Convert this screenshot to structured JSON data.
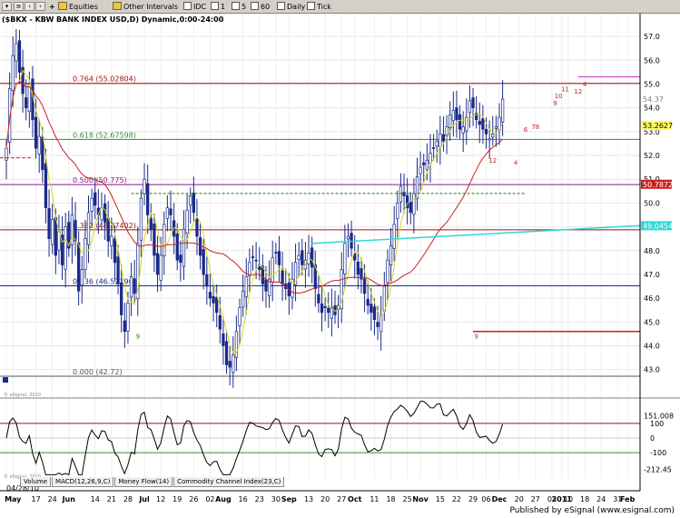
{
  "toolbar": {
    "equities": "Equities",
    "other_intervals": "Other Intervals",
    "idc": "IDC",
    "int_1": "1",
    "int_5": "5",
    "int_60": "60",
    "daily": "Daily",
    "tick": "Tick",
    "add_symbol": "+"
  },
  "chart": {
    "title": "($BKX - KBW BANK INDEX USD,D) Dynamic,0:00-24:00",
    "watermark": "© eSignal, 2010",
    "watermark_lower": "© eSignal, 2010",
    "tabs": [
      "Volume",
      "MACD(12,26,9,C)",
      "Money Flow(14)",
      "Commodity Channel Index(23,C)"
    ],
    "footer": "Published by eSignal (www.esignal.com)",
    "colors": {
      "candle_up": "#ffffff",
      "candle_down": "#1a2a8a",
      "fib_764": "#a01010",
      "fib_618": "#3a8a3a",
      "fib_500": "#8a1a8a",
      "fib_382": "#a01010",
      "fib_236": "#1a2a8a",
      "fib_000": "#555555",
      "ma_short": "#d8d820",
      "ma_long": "#cc2020",
      "trend_cyan": "#30d8d8",
      "support_red": "#cc2020",
      "resistance_green": "#1a7a1a",
      "magenta_line": "#cc20cc",
      "cci_line": "#000000"
    }
  },
  "chart_data": [
    {
      "type": "candlestick",
      "title": "($BKX - KBW BANK INDEX USD,D) Dynamic,0:00-24:00",
      "ylim": [
        42.3,
        57.5
      ],
      "x_labels": [
        {
          "label": "04/28/10",
          "i": 0
        },
        {
          "label": "May",
          "i": 2
        },
        {
          "label": "17",
          "i": 9
        },
        {
          "label": "24",
          "i": 14
        },
        {
          "label": "Jun",
          "i": 19
        },
        {
          "label": "14",
          "i": 27
        },
        {
          "label": "21",
          "i": 32
        },
        {
          "label": "28",
          "i": 37
        },
        {
          "label": "Jul",
          "i": 42
        },
        {
          "label": "12",
          "i": 47
        },
        {
          "label": "19",
          "i": 52
        },
        {
          "label": "26",
          "i": 57
        },
        {
          "label": "02",
          "i": 62
        },
        {
          "label": "Aug",
          "i": 66
        },
        {
          "label": "16",
          "i": 72
        },
        {
          "label": "23",
          "i": 77
        },
        {
          "label": "30",
          "i": 82
        },
        {
          "label": "Sep",
          "i": 86
        },
        {
          "label": "13",
          "i": 92
        },
        {
          "label": "20",
          "i": 97
        },
        {
          "label": "27",
          "i": 102
        },
        {
          "label": "Oct",
          "i": 106
        },
        {
          "label": "11",
          "i": 112
        },
        {
          "label": "18",
          "i": 117
        },
        {
          "label": "25",
          "i": 122
        },
        {
          "label": "Nov",
          "i": 126
        },
        {
          "label": "15",
          "i": 132
        },
        {
          "label": "22",
          "i": 137
        },
        {
          "label": "29",
          "i": 142
        },
        {
          "label": "06",
          "i": 146
        },
        {
          "label": "Dec",
          "i": 150
        },
        {
          "label": "20",
          "i": 156
        },
        {
          "label": "27",
          "i": 161
        },
        {
          "label": "03",
          "i": 166
        },
        {
          "label": "2011",
          "i": 169
        },
        {
          "label": "10",
          "i": 171
        },
        {
          "label": "18",
          "i": 176
        },
        {
          "label": "24",
          "i": 181
        },
        {
          "label": "31",
          "i": 186
        },
        {
          "label": "Feb",
          "i": 189
        }
      ],
      "y_ticks": [
        57.0,
        56.0,
        55.0,
        54.0,
        53.0,
        52.0,
        51.0,
        50.0,
        49.0,
        48.0,
        47.0,
        46.0,
        45.0,
        44.0,
        43.0
      ],
      "price_tags": [
        {
          "text": "54.37",
          "y": 54.37,
          "bg": "#ffffff",
          "fg": "#808080"
        },
        {
          "text": "53.2627",
          "y": 53.2627,
          "bg": "#ffff60",
          "fg": "#000000"
        },
        {
          "text": "50.7872",
          "y": 50.7872,
          "bg": "#cc2020",
          "fg": "#ffffff"
        },
        {
          "text": "49.0454",
          "y": 49.0454,
          "bg": "#30d8d8",
          "fg": "#ffffff"
        }
      ],
      "fib_levels": [
        {
          "label": "0.764 (55.02804)",
          "value": 55.02804,
          "color_key": "fib_764"
        },
        {
          "label": "0.618 (52.67598)",
          "value": 52.67598,
          "color_key": "fib_618"
        },
        {
          "label": "0.500 (50.775)",
          "value": 50.775,
          "color_key": "fib_500"
        },
        {
          "label": "0.382 (48.87402)",
          "value": 48.87402,
          "color_key": "fib_382"
        },
        {
          "label": "0.236 (46.52196)",
          "value": 46.52196,
          "color_key": "fib_236"
        },
        {
          "label": "0.000 (42.72)",
          "value": 42.72,
          "color_key": "fib_000"
        }
      ],
      "demark_counts": [
        {
          "text": "9",
          "i": 40,
          "y": 44.3,
          "color": "green"
        },
        {
          "text": "9",
          "i": 143,
          "y": 44.3,
          "color": "green"
        },
        {
          "text": "12",
          "i": 148,
          "y": 51.7,
          "color": "red"
        },
        {
          "text": "4",
          "i": 155,
          "y": 51.6,
          "color": "red"
        },
        {
          "text": "6",
          "i": 158,
          "y": 53.0,
          "color": "red"
        },
        {
          "text": "78",
          "i": 161,
          "y": 53.1,
          "color": "red"
        },
        {
          "text": "9",
          "i": 167,
          "y": 54.1,
          "color": "red"
        },
        {
          "text": "10",
          "i": 168,
          "y": 54.4,
          "color": "red"
        },
        {
          "text": "11",
          "i": 170,
          "y": 54.7,
          "color": "red"
        },
        {
          "text": "12",
          "i": 174,
          "y": 54.6,
          "color": "red"
        },
        {
          "text": "4",
          "i": 176,
          "y": 54.9,
          "color": "red"
        }
      ],
      "close": [
        52.3,
        54.8,
        56.2,
        56.7,
        55.5,
        54.6,
        54.0,
        55.0,
        53.5,
        52.3,
        52.8,
        51.4,
        49.8,
        48.5,
        49.3,
        47.8,
        48.8,
        47.4,
        49.0,
        48.1,
        49.5,
        48.4,
        46.3,
        47.2,
        48.5,
        49.6,
        50.2,
        49.9,
        49.5,
        49.8,
        49.2,
        48.4,
        48.6,
        47.5,
        46.6,
        45.3,
        44.6,
        45.8,
        46.9,
        46.2,
        48.3,
        50.2,
        51.0,
        49.5,
        48.9,
        47.8,
        47.0,
        47.8,
        49.1,
        49.8,
        49.5,
        48.6,
        47.6,
        47.5,
        48.9,
        49.7,
        50.3,
        49.6,
        48.6,
        47.8,
        47.0,
        46.5,
        46.0,
        45.8,
        45.4,
        44.7,
        44.0,
        43.2,
        43.1,
        43.6,
        44.6,
        45.6,
        46.3,
        46.9,
        47.5,
        47.7,
        47.6,
        47.2,
        46.6,
        46.3,
        46.8,
        47.7,
        47.9,
        47.4,
        46.6,
        46.4,
        46.1,
        46.8,
        47.5,
        47.8,
        47.4,
        47.6,
        47.9,
        47.3,
        46.4,
        45.8,
        45.4,
        45.6,
        45.4,
        45.6,
        45.3,
        45.7,
        47.2,
        48.3,
        48.6,
        48.1,
        47.6,
        47.0,
        46.8,
        46.2,
        45.7,
        45.4,
        45.1,
        44.8,
        45.3,
        46.5,
        47.6,
        48.2,
        49.1,
        50.0,
        50.7,
        50.3,
        49.8,
        49.6,
        50.4,
        51.1,
        51.5,
        51.6,
        51.8,
        52.1,
        52.3,
        52.6,
        52.9,
        52.6,
        53.2,
        53.7,
        53.9,
        53.5,
        53.1,
        53.2,
        53.6,
        54.3,
        54.0,
        53.5,
        53.3,
        53.1,
        52.9,
        52.7,
        52.9,
        53.2,
        53.6,
        54.37
      ],
      "sma_short": [],
      "sma_long": [],
      "cci": []
    }
  ]
}
